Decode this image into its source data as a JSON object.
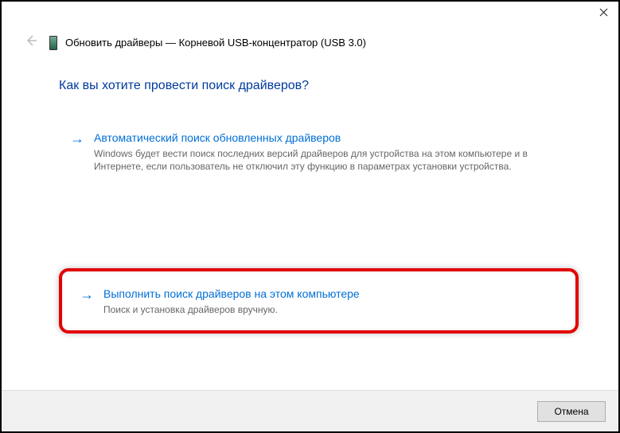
{
  "window": {
    "title": "Обновить драйверы — Корневой USB-концентратор (USB 3.0)"
  },
  "content": {
    "question": "Как вы хотите провести поиск драйверов?"
  },
  "options": {
    "auto": {
      "title": "Автоматический поиск обновленных драйверов",
      "desc": "Windows будет вести поиск последних версий драйверов для устройства на этом компьютере и в Интернете, если пользователь не отключил эту функцию в параметрах установки устройства."
    },
    "manual": {
      "title": "Выполнить поиск драйверов на этом компьютере",
      "desc": "Поиск и установка драйверов вручную."
    }
  },
  "footer": {
    "cancel": "Отмена"
  }
}
